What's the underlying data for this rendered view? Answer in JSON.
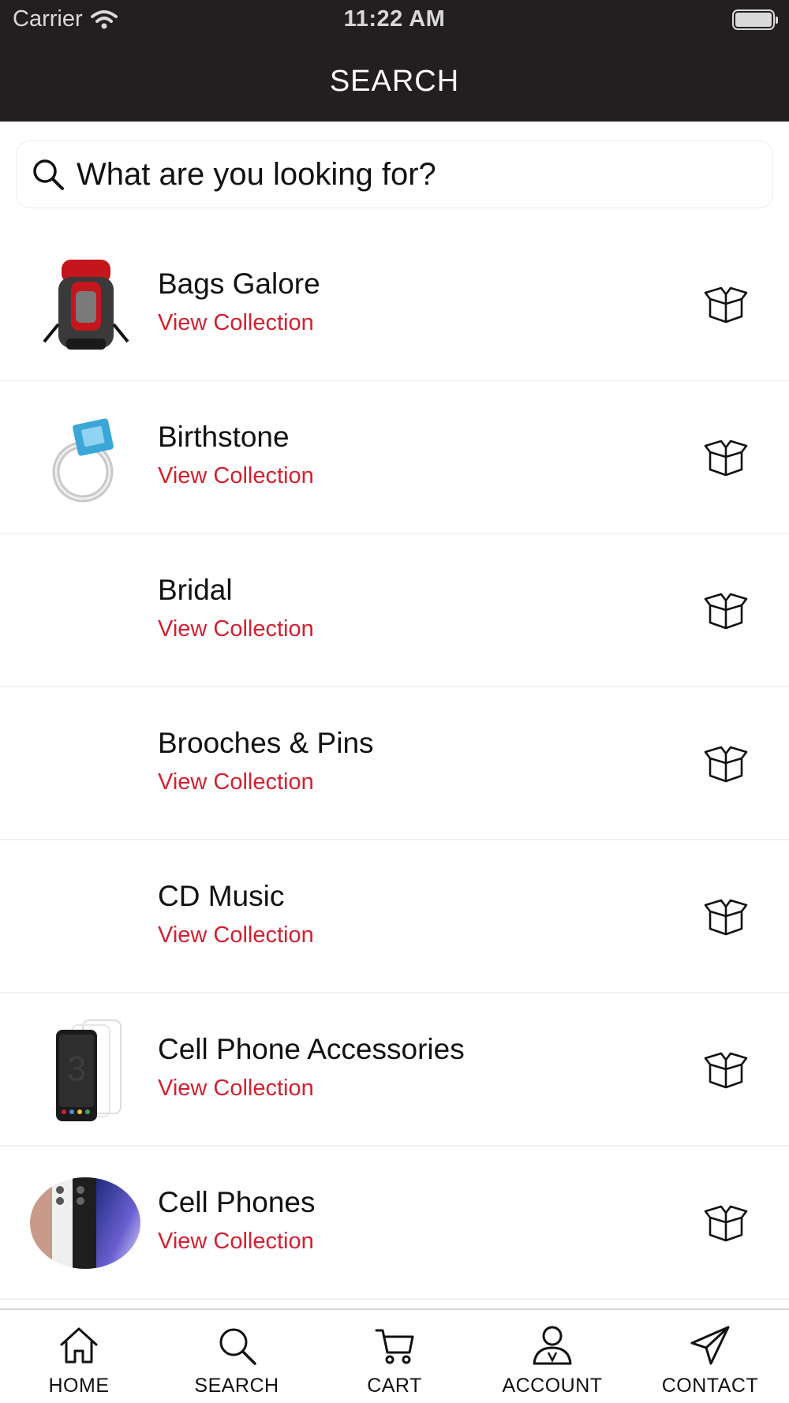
{
  "status_bar": {
    "carrier": "Carrier",
    "time": "11:22 AM"
  },
  "header": {
    "title": "SEARCH"
  },
  "search": {
    "placeholder": "What are you looking for?",
    "value": ""
  },
  "collections": [
    {
      "name": "Bags Galore",
      "link": "View Collection",
      "thumb": "backpack"
    },
    {
      "name": "Birthstone",
      "link": "View Collection",
      "thumb": "ring"
    },
    {
      "name": "Bridal",
      "link": "View Collection",
      "thumb": "none"
    },
    {
      "name": "Brooches & Pins",
      "link": "View Collection",
      "thumb": "none"
    },
    {
      "name": "CD Music",
      "link": "View Collection",
      "thumb": "none"
    },
    {
      "name": "Cell Phone Accessories",
      "link": "View Collection",
      "thumb": "phone-case"
    },
    {
      "name": "Cell Phones",
      "link": "View Collection",
      "thumb": "phones"
    }
  ],
  "tab_bar": {
    "items": [
      {
        "label": "HOME",
        "icon": "home-icon"
      },
      {
        "label": "SEARCH",
        "icon": "search-icon"
      },
      {
        "label": "CART",
        "icon": "cart-icon"
      },
      {
        "label": "ACCOUNT",
        "icon": "account-icon"
      },
      {
        "label": "CONTACT",
        "icon": "paper-plane-icon"
      }
    ]
  },
  "colors": {
    "header_bg": "#231f20",
    "accent_red": "#d3202f",
    "text": "#111111"
  }
}
